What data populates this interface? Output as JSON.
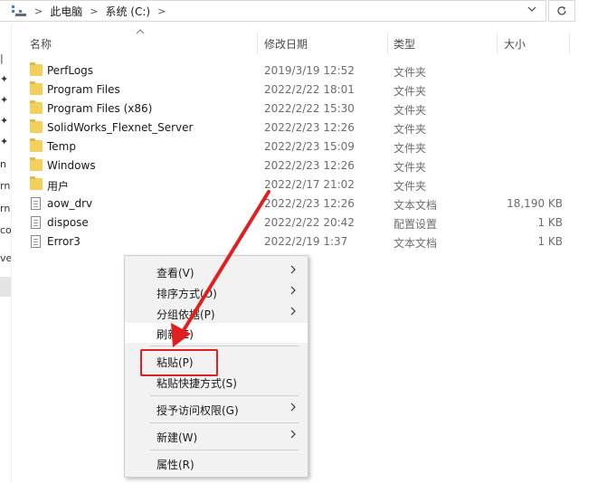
{
  "address_bar": {
    "crumbs": [
      "此电脑",
      "系统 (C:)"
    ],
    "separator": ">",
    "dropdown_icon": "chevron-down-icon",
    "refresh_icon": "refresh-icon"
  },
  "left_pane_fragments": [
    "n",
    "rn",
    "rn",
    "co",
    "ve"
  ],
  "columns": {
    "name": "名称",
    "modified": "修改日期",
    "type": "类型",
    "size": "大小"
  },
  "files": [
    {
      "name": "PerfLogs",
      "modified": "2019/3/19 12:52",
      "type": "文件夹",
      "size": "",
      "kind": "folder"
    },
    {
      "name": "Program Files",
      "modified": "2022/2/22 18:01",
      "type": "文件夹",
      "size": "",
      "kind": "folder"
    },
    {
      "name": "Program Files (x86)",
      "modified": "2022/2/22 15:30",
      "type": "文件夹",
      "size": "",
      "kind": "folder"
    },
    {
      "name": "SolidWorks_Flexnet_Server",
      "modified": "2022/2/23 12:26",
      "type": "文件夹",
      "size": "",
      "kind": "folder"
    },
    {
      "name": "Temp",
      "modified": "2022/2/23 15:09",
      "type": "文件夹",
      "size": "",
      "kind": "folder"
    },
    {
      "name": "Windows",
      "modified": "2022/2/23 12:26",
      "type": "文件夹",
      "size": "",
      "kind": "folder"
    },
    {
      "name": "用户",
      "modified": "2022/2/17 21:02",
      "type": "文件夹",
      "size": "",
      "kind": "folder"
    },
    {
      "name": "aow_drv",
      "modified": "2022/2/23 12:26",
      "type": "文本文档",
      "size": "18,190 KB",
      "kind": "file"
    },
    {
      "name": "dispose",
      "modified": "2022/2/22 20:42",
      "type": "配置设置",
      "size": "1 KB",
      "kind": "file"
    },
    {
      "name": "Error3",
      "modified": "2022/2/19 1:37",
      "type": "文本文档",
      "size": "1 KB",
      "kind": "file"
    }
  ],
  "context_menu": {
    "items": [
      {
        "label": "查看(V)",
        "submenu": true
      },
      {
        "label": "排序方式(O)",
        "submenu": true
      },
      {
        "label": "分组依据(P)",
        "submenu": true
      },
      {
        "label": "刷新(E)",
        "submenu": false
      },
      {
        "label": "粘贴(P)",
        "submenu": false,
        "highlighted": true
      },
      {
        "label": "粘贴快捷方式(S)",
        "submenu": false
      },
      {
        "label": "授予访问权限(G)",
        "submenu": true
      },
      {
        "label": "新建(W)",
        "submenu": true
      },
      {
        "label": "属性(R)",
        "submenu": false
      }
    ]
  },
  "colors": {
    "annotation": "#e02020",
    "folder": "#f5cf5c",
    "menu_bg": "#f2f2f2"
  }
}
